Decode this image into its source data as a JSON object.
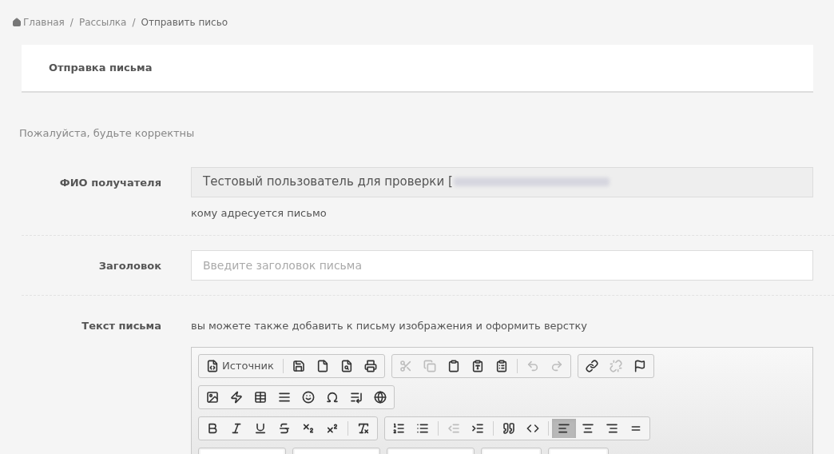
{
  "breadcrumb": [
    {
      "label": "Главная",
      "kind": "home"
    },
    {
      "label": "Рассылка",
      "kind": "link",
      "separator": "/"
    },
    {
      "label": "Отправить письо",
      "kind": "current",
      "separator": "/"
    }
  ],
  "card": {
    "title": "Отправка письма"
  },
  "notice": "Пожалуйста, будьте корректны",
  "fields": [
    {
      "kind": "readonly",
      "label": "ФИО получателя",
      "value": "Тестовый пользователь для проверки [",
      "redacted": true,
      "help": "кому адресуется письмо"
    },
    {
      "kind": "input",
      "label": "Заголовок",
      "placeholder": "Введите заголовок письма"
    },
    {
      "kind": "editor",
      "label": "Текст письма",
      "help": "вы можете также добавить к письму изображения и оформить верстку"
    }
  ],
  "toolbar": [
    [
      [
        {
          "kind": "source",
          "label": "Источник",
          "disabled": false,
          "selected": false
        },
        {
          "kind": "separator"
        },
        {
          "kind": "save",
          "disabled": false,
          "selected": false
        },
        {
          "kind": "new-page",
          "disabled": false,
          "selected": false
        },
        {
          "kind": "preview",
          "disabled": false,
          "selected": false
        },
        {
          "kind": "print",
          "disabled": false,
          "selected": false
        }
      ],
      [
        {
          "kind": "cut",
          "disabled": true,
          "selected": false
        },
        {
          "kind": "copy",
          "disabled": true,
          "selected": false
        },
        {
          "kind": "paste",
          "disabled": false,
          "selected": false
        },
        {
          "kind": "paste-text",
          "disabled": false,
          "selected": false
        },
        {
          "kind": "paste-word",
          "disabled": false,
          "selected": false
        },
        {
          "kind": "separator"
        },
        {
          "kind": "undo",
          "disabled": true,
          "selected": false
        },
        {
          "kind": "redo",
          "disabled": true,
          "selected": false
        }
      ],
      [
        {
          "kind": "link",
          "disabled": false,
          "selected": false
        },
        {
          "kind": "unlink",
          "disabled": true,
          "selected": false
        },
        {
          "kind": "anchor",
          "disabled": false,
          "selected": false
        }
      ]
    ],
    [
      [
        {
          "kind": "image",
          "disabled": false,
          "selected": false
        },
        {
          "kind": "flash",
          "disabled": false,
          "selected": false
        },
        {
          "kind": "table",
          "disabled": false,
          "selected": false
        },
        {
          "kind": "hr",
          "disabled": false,
          "selected": false
        },
        {
          "kind": "smiley",
          "disabled": false,
          "selected": false
        },
        {
          "kind": "special-char",
          "disabled": false,
          "selected": false
        },
        {
          "kind": "page-break",
          "disabled": false,
          "selected": false
        },
        {
          "kind": "iframe",
          "disabled": false,
          "selected": false
        }
      ]
    ],
    [
      [
        {
          "kind": "bold",
          "disabled": false,
          "selected": false
        },
        {
          "kind": "italic",
          "disabled": false,
          "selected": false
        },
        {
          "kind": "underline",
          "disabled": false,
          "selected": false
        },
        {
          "kind": "strike",
          "disabled": false,
          "selected": false
        },
        {
          "kind": "subscript",
          "disabled": false,
          "selected": false
        },
        {
          "kind": "superscript",
          "disabled": false,
          "selected": false
        },
        {
          "kind": "separator"
        },
        {
          "kind": "remove-format",
          "disabled": false,
          "selected": false
        }
      ],
      [
        {
          "kind": "numbered-list",
          "disabled": false,
          "selected": false
        },
        {
          "kind": "bulleted-list",
          "disabled": false,
          "selected": false
        },
        {
          "kind": "separator"
        },
        {
          "kind": "outdent",
          "disabled": true,
          "selected": false
        },
        {
          "kind": "indent",
          "disabled": false,
          "selected": false
        },
        {
          "kind": "separator"
        },
        {
          "kind": "blockquote",
          "disabled": false,
          "selected": false
        },
        {
          "kind": "div",
          "disabled": false,
          "selected": false
        },
        {
          "kind": "separator"
        },
        {
          "kind": "align-left",
          "disabled": false,
          "selected": true
        },
        {
          "kind": "align-center",
          "disabled": false,
          "selected": false
        },
        {
          "kind": "align-right",
          "disabled": false,
          "selected": false
        },
        {
          "kind": "justify",
          "disabled": false,
          "selected": false
        }
      ]
    ],
    [
      [
        {
          "kind": "combo"
        }
      ],
      [
        {
          "kind": "combo"
        }
      ],
      [
        {
          "kind": "combo"
        }
      ],
      [
        {
          "kind": "combo-small"
        }
      ],
      [
        {
          "kind": "combo-small"
        }
      ]
    ]
  ]
}
